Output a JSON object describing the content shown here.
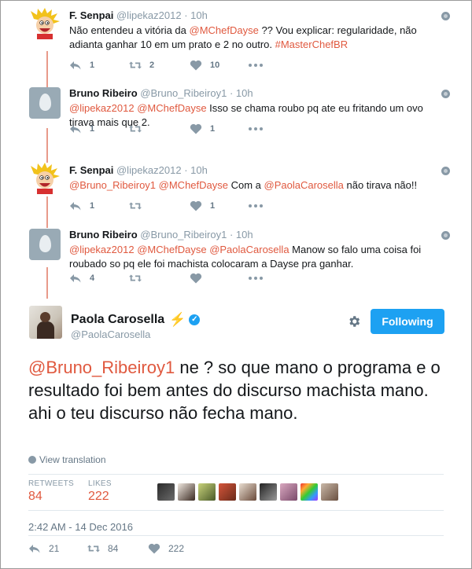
{
  "replies": [
    {
      "name": "F. Senpai",
      "handle": "@lipekaz2012",
      "dot": "·",
      "time": "10h",
      "avatar": "calvin-avatar",
      "text_parts": [
        {
          "t": "Não entendeu a vitória da ",
          "k": "plain"
        },
        {
          "t": "@MChefDayse",
          "k": "mention"
        },
        {
          "t": " ?? Vou explicar: regularidade, não adianta ganhar 10 em um prato e 2 no outro. ",
          "k": "plain"
        },
        {
          "t": "#MasterChefBR",
          "k": "hashtag"
        }
      ],
      "reply_count": "1",
      "retweet_count": "2",
      "like_count": "10"
    },
    {
      "name": "Bruno Ribeiro",
      "handle": "@Bruno_Ribeiroy1",
      "dot": "·",
      "time": "10h",
      "avatar": "egg-avatar",
      "text_parts": [
        {
          "t": "@lipekaz2012",
          "k": "mention"
        },
        {
          "t": " ",
          "k": "plain"
        },
        {
          "t": "@MChefDayse",
          "k": "mention"
        },
        {
          "t": " Isso se chama roubo pq ate eu fritando um ovo tirava mais que 2.",
          "k": "plain"
        }
      ],
      "reply_count": "1",
      "retweet_count": "",
      "like_count": "1"
    },
    {
      "name": "F. Senpai",
      "handle": "@lipekaz2012",
      "dot": "·",
      "time": "10h",
      "avatar": "calvin-avatar",
      "text_parts": [
        {
          "t": "@Bruno_Ribeiroy1",
          "k": "mention"
        },
        {
          "t": " ",
          "k": "plain"
        },
        {
          "t": "@MChefDayse",
          "k": "mention"
        },
        {
          "t": " Com a ",
          "k": "plain"
        },
        {
          "t": "@PaolaCarosella",
          "k": "mention"
        },
        {
          "t": " não tirava não!!",
          "k": "plain"
        }
      ],
      "reply_count": "1",
      "retweet_count": "",
      "like_count": "1"
    },
    {
      "name": "Bruno Ribeiro",
      "handle": "@Bruno_Ribeiroy1",
      "dot": "·",
      "time": "10h",
      "avatar": "egg-avatar",
      "text_parts": [
        {
          "t": "@lipekaz2012",
          "k": "mention"
        },
        {
          "t": " ",
          "k": "plain"
        },
        {
          "t": "@MChefDayse",
          "k": "mention"
        },
        {
          "t": " ",
          "k": "plain"
        },
        {
          "t": "@PaolaCarosella",
          "k": "mention"
        },
        {
          "t": " Manow so falo uma coisa foi roubado so pq ele foi machista colocaram a Dayse pra ganhar.",
          "k": "plain"
        }
      ],
      "reply_count": "4",
      "retweet_count": "",
      "like_count": ""
    }
  ],
  "main": {
    "name": "Paola Carosella",
    "handle": "@PaolaCarosella",
    "bolt": "⚡",
    "verified_mark": "✓",
    "follow_label": "Following",
    "mention": "@Bruno_Ribeiroy1",
    "body": "  ne ? so que mano o programa e o resultado foi bem antes do discurso machista mano. ahi o teu discurso não fecha mano.",
    "view_translation": "View translation",
    "retweets_label": "RETWEETS",
    "retweets_value": "84",
    "likes_label": "LIKES",
    "likes_value": "222",
    "timestamp": "2:42 AM - 14 Dec 2016",
    "reply_count": "21",
    "retweet_count": "84",
    "like_count": "222"
  },
  "colors": {
    "link": "#e0593f",
    "thread_line": "#e89a8a",
    "follow_bg": "#1da1f2",
    "muted": "#8899a6"
  },
  "icons": [
    "reply-icon",
    "retweet-icon",
    "heart-icon",
    "more-icon",
    "globe-icon",
    "gear-icon",
    "verified-icon",
    "lightning-icon"
  ]
}
